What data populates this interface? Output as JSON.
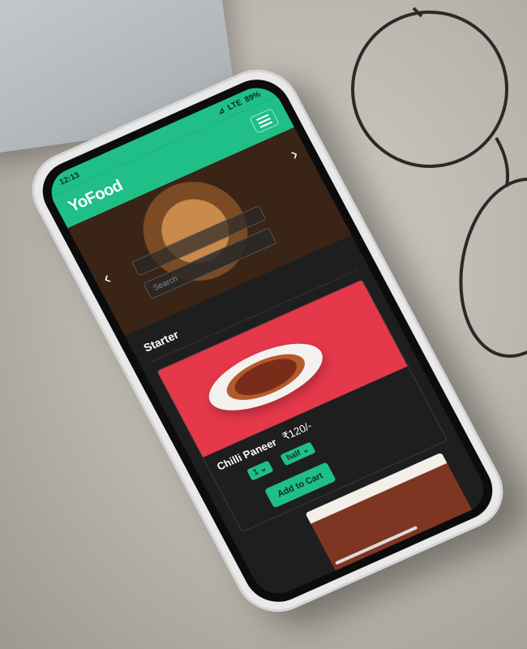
{
  "status": {
    "time": "12:13",
    "network": "LTE",
    "battery": "89%"
  },
  "navbar": {
    "brand": "YoFood"
  },
  "hero": {
    "search_placeholder": "Search"
  },
  "menu": {
    "section_title": "Starter",
    "item": {
      "name": "Chilli Paneer",
      "price": "₹120/-",
      "quantity": "1",
      "portion": "half",
      "add_to_cart": "Add to Cart"
    }
  },
  "colors": {
    "accent": "#1fbf87",
    "card_bg": "#e5384a",
    "screen_bg": "#1e1e1e"
  }
}
